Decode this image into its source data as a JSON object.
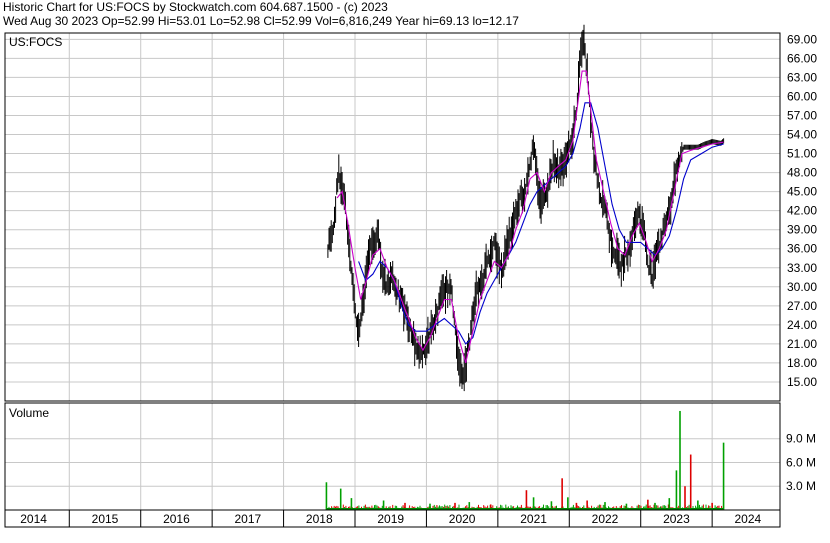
{
  "header": {
    "line1": "Historic Chart for US:FOCS by Stockwatch.com 604.687.1500 - (c) 2023",
    "line2": "Wed Aug 30 2023   Op=52.99  Hi=53.01  Lo=52.98  Cl=52.99  Vol=6,816,249  Year hi=69.13  lo=12.17"
  },
  "chart_data": {
    "type": "line",
    "symbol_label": "US:FOCS",
    "volume_label": "Volume",
    "price_axis": {
      "min": 12,
      "max": 70,
      "ticks": [
        "69.00",
        "66.00",
        "63.00",
        "60.00",
        "57.00",
        "54.00",
        "51.00",
        "48.00",
        "45.00",
        "42.00",
        "39.00",
        "36.00",
        "33.00",
        "30.00",
        "27.00",
        "24.00",
        "21.00",
        "18.00",
        "15.00"
      ]
    },
    "volume_axis": {
      "min": 0,
      "max": 13,
      "unit": "M",
      "ticks": [
        "9.0 M",
        "6.0 M",
        "3.0 M"
      ]
    },
    "x_axis": {
      "min": 2013.6,
      "max": 2024.45,
      "year_labels": [
        "2014",
        "2015",
        "2016",
        "2017",
        "2018",
        "2019",
        "2020",
        "2021",
        "2022",
        "2023",
        "2024"
      ]
    },
    "grid": true,
    "colors": {
      "price": "#000000",
      "ma_short": "#cc00cc",
      "ma_long": "#0000cc",
      "vol_up": "#00a000",
      "vol_down": "#dd0000",
      "grid": "#c8c8c8",
      "vol_baseline": "#008800"
    },
    "price_series": [
      [
        2018.12,
        36
      ],
      [
        2018.2,
        40
      ],
      [
        2018.27,
        48
      ],
      [
        2018.33,
        46
      ],
      [
        2018.38,
        41
      ],
      [
        2018.44,
        33
      ],
      [
        2018.5,
        26
      ],
      [
        2018.55,
        23
      ],
      [
        2018.62,
        28
      ],
      [
        2018.68,
        35
      ],
      [
        2018.75,
        37
      ],
      [
        2018.82,
        38
      ],
      [
        2018.88,
        33
      ],
      [
        2018.94,
        30
      ],
      [
        2019.02,
        32
      ],
      [
        2019.1,
        29
      ],
      [
        2019.2,
        26
      ],
      [
        2019.28,
        23
      ],
      [
        2019.35,
        21
      ],
      [
        2019.42,
        19
      ],
      [
        2019.5,
        21
      ],
      [
        2019.6,
        24
      ],
      [
        2019.7,
        28
      ],
      [
        2019.78,
        30
      ],
      [
        2019.85,
        29
      ],
      [
        2019.9,
        24
      ],
      [
        2019.96,
        18
      ],
      [
        2020.0,
        15
      ],
      [
        2020.05,
        18
      ],
      [
        2020.12,
        23
      ],
      [
        2020.2,
        29
      ],
      [
        2020.28,
        31
      ],
      [
        2020.35,
        34
      ],
      [
        2020.45,
        37
      ],
      [
        2020.55,
        32
      ],
      [
        2020.63,
        37
      ],
      [
        2020.72,
        40
      ],
      [
        2020.8,
        44
      ],
      [
        2020.88,
        45
      ],
      [
        2020.95,
        50
      ],
      [
        2021.0,
        52
      ],
      [
        2021.05,
        47
      ],
      [
        2021.1,
        43
      ],
      [
        2021.2,
        46
      ],
      [
        2021.28,
        50
      ],
      [
        2021.36,
        48
      ],
      [
        2021.44,
        50
      ],
      [
        2021.52,
        52
      ],
      [
        2021.6,
        58
      ],
      [
        2021.66,
        67
      ],
      [
        2021.71,
        68
      ],
      [
        2021.76,
        63
      ],
      [
        2021.8,
        56
      ],
      [
        2021.85,
        50
      ],
      [
        2021.92,
        45
      ],
      [
        2022.0,
        43
      ],
      [
        2022.08,
        37
      ],
      [
        2022.16,
        35
      ],
      [
        2022.22,
        33
      ],
      [
        2022.3,
        35
      ],
      [
        2022.38,
        38
      ],
      [
        2022.46,
        42
      ],
      [
        2022.54,
        39
      ],
      [
        2022.6,
        34
      ],
      [
        2022.66,
        32
      ],
      [
        2022.72,
        36
      ],
      [
        2022.8,
        38
      ],
      [
        2022.86,
        41
      ],
      [
        2022.92,
        43
      ],
      [
        2022.98,
        47
      ],
      [
        2023.04,
        50
      ],
      [
        2023.1,
        52
      ],
      [
        2023.2,
        52
      ],
      [
        2023.3,
        52
      ],
      [
        2023.4,
        52.5
      ],
      [
        2023.5,
        52.9
      ],
      [
        2023.62,
        52.6
      ],
      [
        2023.66,
        53
      ]
    ],
    "ma_short_series": [
      [
        2018.25,
        44
      ],
      [
        2018.32,
        45
      ],
      [
        2018.4,
        40
      ],
      [
        2018.5,
        33
      ],
      [
        2018.58,
        28
      ],
      [
        2018.66,
        31
      ],
      [
        2018.75,
        35
      ],
      [
        2018.85,
        36
      ],
      [
        2018.95,
        33
      ],
      [
        2019.05,
        31
      ],
      [
        2019.15,
        28
      ],
      [
        2019.25,
        25
      ],
      [
        2019.35,
        22
      ],
      [
        2019.45,
        20
      ],
      [
        2019.55,
        22
      ],
      [
        2019.65,
        25
      ],
      [
        2019.75,
        28
      ],
      [
        2019.85,
        28
      ],
      [
        2019.95,
        22
      ],
      [
        2020.05,
        18
      ],
      [
        2020.15,
        23
      ],
      [
        2020.25,
        28
      ],
      [
        2020.35,
        31
      ],
      [
        2020.45,
        34
      ],
      [
        2020.55,
        33
      ],
      [
        2020.65,
        35
      ],
      [
        2020.75,
        39
      ],
      [
        2020.85,
        42
      ],
      [
        2020.95,
        47
      ],
      [
        2021.05,
        48
      ],
      [
        2021.15,
        45
      ],
      [
        2021.25,
        48
      ],
      [
        2021.35,
        49
      ],
      [
        2021.45,
        50
      ],
      [
        2021.55,
        53
      ],
      [
        2021.62,
        59
      ],
      [
        2021.68,
        64
      ],
      [
        2021.74,
        64
      ],
      [
        2021.8,
        58
      ],
      [
        2021.88,
        50
      ],
      [
        2021.98,
        45
      ],
      [
        2022.08,
        40
      ],
      [
        2022.18,
        36
      ],
      [
        2022.28,
        35
      ],
      [
        2022.38,
        38
      ],
      [
        2022.48,
        40
      ],
      [
        2022.58,
        37
      ],
      [
        2022.66,
        34
      ],
      [
        2022.76,
        36
      ],
      [
        2022.86,
        39
      ],
      [
        2022.95,
        44
      ],
      [
        2023.02,
        48
      ],
      [
        2023.08,
        51
      ],
      [
        2023.2,
        51.5
      ],
      [
        2023.35,
        52
      ],
      [
        2023.5,
        52.5
      ],
      [
        2023.66,
        52.8
      ]
    ],
    "ma_long_series": [
      [
        2018.55,
        34
      ],
      [
        2018.65,
        31
      ],
      [
        2018.75,
        32
      ],
      [
        2018.85,
        34
      ],
      [
        2018.95,
        33
      ],
      [
        2019.05,
        31
      ],
      [
        2019.15,
        27
      ],
      [
        2019.25,
        24
      ],
      [
        2019.35,
        23
      ],
      [
        2019.5,
        23
      ],
      [
        2019.62,
        24
      ],
      [
        2019.75,
        25
      ],
      [
        2019.85,
        24
      ],
      [
        2019.95,
        23
      ],
      [
        2020.05,
        21
      ],
      [
        2020.15,
        22
      ],
      [
        2020.25,
        26
      ],
      [
        2020.35,
        29
      ],
      [
        2020.45,
        31
      ],
      [
        2020.55,
        33
      ],
      [
        2020.65,
        35
      ],
      [
        2020.75,
        37
      ],
      [
        2020.85,
        40
      ],
      [
        2020.95,
        43
      ],
      [
        2021.05,
        45
      ],
      [
        2021.15,
        46
      ],
      [
        2021.25,
        47
      ],
      [
        2021.35,
        48
      ],
      [
        2021.45,
        49
      ],
      [
        2021.55,
        51
      ],
      [
        2021.65,
        55
      ],
      [
        2021.72,
        59
      ],
      [
        2021.8,
        59
      ],
      [
        2021.9,
        55
      ],
      [
        2022.0,
        49
      ],
      [
        2022.1,
        43
      ],
      [
        2022.2,
        39
      ],
      [
        2022.3,
        37
      ],
      [
        2022.4,
        37
      ],
      [
        2022.5,
        37
      ],
      [
        2022.6,
        36
      ],
      [
        2022.7,
        35
      ],
      [
        2022.8,
        36
      ],
      [
        2022.9,
        38
      ],
      [
        2023.0,
        42
      ],
      [
        2023.1,
        47
      ],
      [
        2023.2,
        50
      ],
      [
        2023.35,
        51
      ],
      [
        2023.5,
        52
      ],
      [
        2023.66,
        52.5
      ]
    ],
    "volume_spikes": [
      [
        2018.1,
        3.5,
        "up"
      ],
      [
        2018.3,
        2.7,
        "up"
      ],
      [
        2018.45,
        1.5,
        "up"
      ],
      [
        2018.9,
        1.2,
        "up"
      ],
      [
        2019.2,
        0.9,
        "down"
      ],
      [
        2019.55,
        0.8,
        "up"
      ],
      [
        2019.9,
        0.9,
        "down"
      ],
      [
        2020.1,
        1.0,
        "up"
      ],
      [
        2020.4,
        0.7,
        "down"
      ],
      [
        2020.9,
        2.5,
        "down"
      ],
      [
        2021.0,
        1.6,
        "up"
      ],
      [
        2021.25,
        1.1,
        "up"
      ],
      [
        2021.4,
        4.0,
        "down"
      ],
      [
        2021.48,
        1.6,
        "up"
      ],
      [
        2021.6,
        0.9,
        "down"
      ],
      [
        2021.75,
        1.2,
        "down"
      ],
      [
        2022.0,
        1.0,
        "up"
      ],
      [
        2022.3,
        0.8,
        "up"
      ],
      [
        2022.6,
        1.3,
        "down"
      ],
      [
        2022.7,
        0.9,
        "up"
      ],
      [
        2022.9,
        1.5,
        "up"
      ],
      [
        2023.0,
        5.0,
        "up"
      ],
      [
        2023.05,
        12.5,
        "up"
      ],
      [
        2023.12,
        3.0,
        "down"
      ],
      [
        2023.2,
        7.0,
        "down"
      ],
      [
        2023.3,
        1.2,
        "up"
      ],
      [
        2023.5,
        0.9,
        "down"
      ],
      [
        2023.66,
        8.5,
        "up"
      ]
    ]
  }
}
